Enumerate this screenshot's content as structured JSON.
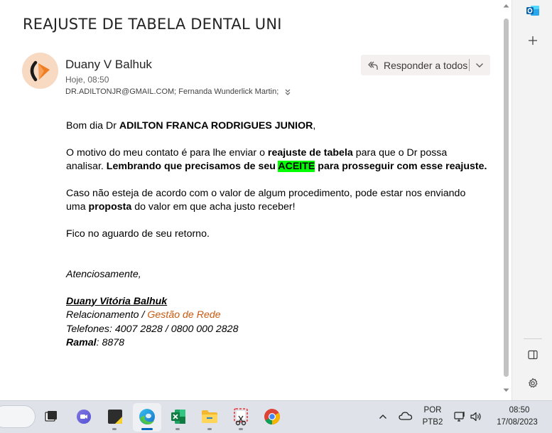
{
  "email": {
    "subject": "REAJUSTE DE TABELA DENTAL UNI",
    "sender_name": "Duany V Balhuk",
    "sent_time": "Hoje, 08:50",
    "recipients": "DR.ADILTONJR@GMAIL.COM; Fernanda Wunderlick Martin;",
    "reply_all_label": "Responder a todos",
    "body": {
      "greeting_prefix": "Bom dia Dr ",
      "greeting_name": "ADILTON FRANCA RODRIGUES JUNIOR",
      "greeting_suffix": ",",
      "p2_a": "O motivo do meu contato é para lhe enviar o ",
      "p2_b": "reajuste de tabela",
      "p2_c": " para que o Dr possa",
      "p2_d": "analisar. ",
      "p2_e": "Lembrando que precisamos de seu ",
      "p2_f": "ACEITE",
      "p2_g": " para prosseguir com esse reajuste.",
      "p3_a": "Caso não esteja de acordo com o valor de algum procedimento, pode estar nos enviando",
      "p3_b": "uma ",
      "p3_c": "proposta",
      "p3_d": " do valor em que acha justo receber!",
      "p4": "Fico no aguardo de seu retorno."
    },
    "signature": {
      "closing": "Atenciosamente,",
      "name": "Duany Vitória Balhuk ",
      "role_a": "Relacionamento / ",
      "role_b": "Gestão de Rede",
      "phones": "Telefones: 4007 2828 / 0800 000 2828",
      "ext_label": "Ramal",
      "ext_value": ": 8878"
    }
  },
  "right_bar": {
    "icons": [
      "outlook-icon",
      "add-icon",
      "panel-icon",
      "settings-icon"
    ]
  },
  "taskbar": {
    "apps": [
      "task-view-icon",
      "teams-chat-icon",
      "sticky-notes-icon",
      "edge-icon",
      "excel-icon",
      "file-explorer-icon",
      "snipping-tool-icon",
      "chrome-icon"
    ],
    "language": "POR",
    "keyboard": "PTB2",
    "time": "08:50",
    "date": "17/08/2023"
  },
  "colors": {
    "highlight": "#00ff00",
    "accent_orange": "#c55a11",
    "avatar_bg": "#f8d9c2",
    "taskbar_bg": "#dfe3e9"
  }
}
